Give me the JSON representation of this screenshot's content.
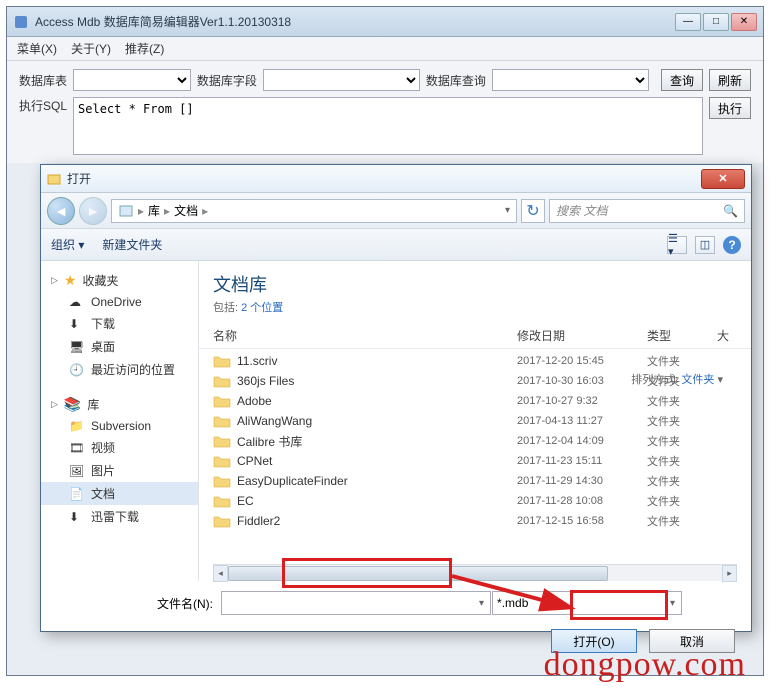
{
  "app": {
    "title": "Access Mdb 数据库简易编辑器Ver1.1.20130318",
    "menu": [
      "菜单(X)",
      "关于(Y)",
      "推荐(Z)"
    ],
    "labels": {
      "table": "数据库表",
      "field": "数据库字段",
      "query": "数据库查询",
      "btn_query": "查询",
      "btn_refresh": "刷新",
      "sql": "执行SQL",
      "btn_exec": "执行"
    },
    "sql_text": "Select * From []"
  },
  "dialog": {
    "title": "打开",
    "breadcrumb": [
      "库",
      "文档"
    ],
    "search_placeholder": "搜索 文档",
    "toolbar": {
      "organize": "组织",
      "newfolder": "新建文件夹"
    },
    "sidebar": {
      "fav_header": "收藏夹",
      "fav_items": [
        "OneDrive",
        "下载",
        "桌面",
        "最近访问的位置"
      ],
      "lib_header": "库",
      "lib_items": [
        "Subversion",
        "视频",
        "图片",
        "文档",
        "迅雷下载"
      ],
      "selected": "文档"
    },
    "pane": {
      "title": "文档库",
      "subtitle_prefix": "包括: ",
      "subtitle_link": "2 个位置",
      "sort_label": "排列方式:",
      "sort_value": "文件夹",
      "cols": {
        "name": "名称",
        "date": "修改日期",
        "type": "类型",
        "size": "大"
      },
      "rows": [
        {
          "name": "11.scriv",
          "date": "2017-12-20 15:45",
          "type": "文件夹"
        },
        {
          "name": "360js Files",
          "date": "2017-10-30 16:03",
          "type": "文件夹"
        },
        {
          "name": "Adobe",
          "date": "2017-10-27 9:32",
          "type": "文件夹"
        },
        {
          "name": "AliWangWang",
          "date": "2017-04-13 11:27",
          "type": "文件夹"
        },
        {
          "name": "Calibre 书库",
          "date": "2017-12-04 14:09",
          "type": "文件夹"
        },
        {
          "name": "CPNet",
          "date": "2017-11-23 15:11",
          "type": "文件夹"
        },
        {
          "name": "EasyDuplicateFinder",
          "date": "2017-11-29 14:30",
          "type": "文件夹"
        },
        {
          "name": "EC",
          "date": "2017-11-28 10:08",
          "type": "文件夹"
        },
        {
          "name": "Fiddler2",
          "date": "2017-12-15 16:58",
          "type": "文件夹"
        }
      ]
    },
    "footer": {
      "filename_label": "文件名(N):",
      "filename_value": "",
      "filter": "*.mdb",
      "open": "打开(O)",
      "cancel": "取消"
    }
  },
  "watermark": "dongpow.com"
}
